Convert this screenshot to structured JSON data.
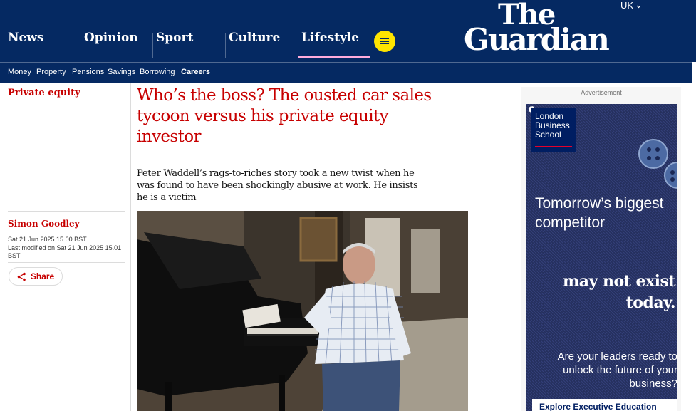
{
  "header": {
    "pillars": [
      "News",
      "Opinion",
      "Sport",
      "Culture",
      "Lifestyle"
    ],
    "active_pillar": "Lifestyle",
    "edition": "UK",
    "logo": {
      "line1": "The",
      "line2": "Guardian"
    },
    "menu_icon": "menu-icon"
  },
  "subnav": {
    "items": [
      "Money",
      "Property",
      "Pensions",
      "Savings",
      "Borrowing",
      "Careers"
    ],
    "active": "Careers"
  },
  "article": {
    "section": "Private equity",
    "headline": "Who’s the boss? The ousted car sales tycoon versus his private equity investor",
    "standfirst": "Peter Waddell’s rags-to-riches story took a new twist when he was found to have been shockingly abusive at work. He insists he is a victim",
    "byline": "Simon Goodley",
    "published": "Sat 21 Jun 2025 15.00 BST",
    "modified": "Last modified on Sat 21 Jun 2025 15.01 BST",
    "share_label": "Share",
    "share_icon": "share-icon"
  },
  "advert": {
    "label": "Advertisement",
    "brand": "London Business School",
    "line1": "Tomorrow’s biggest competitor",
    "line2": "may not exist today.",
    "line3": "Are your leaders ready to unlock the future of your business?",
    "cta": "Explore Executive Education"
  },
  "colors": {
    "brand_blue": "#052962",
    "news_red": "#c70000",
    "lifestyle_pink": "#ffabdb",
    "menu_yellow": "#ffe500"
  }
}
